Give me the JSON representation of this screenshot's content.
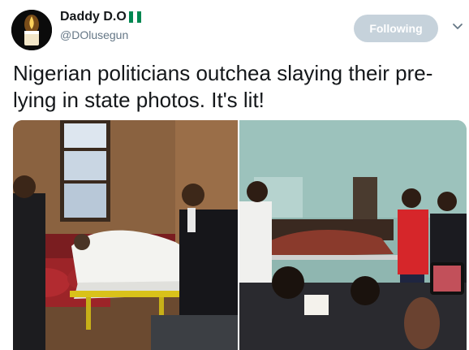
{
  "author": {
    "display_name": "Daddy D.O",
    "handle": "@DOlusegun",
    "flag_colors": [
      "#008751",
      "#ffffff",
      "#008751"
    ]
  },
  "follow_button": {
    "label": "Following",
    "color": "#c6d2db"
  },
  "tweet": {
    "text": "Nigerian politicians outchea slaying their pre-lying in state photos. It's lit!"
  },
  "media": [
    {
      "name": "photo-hospital-stretcher-left"
    },
    {
      "name": "photo-hospital-ward-right"
    }
  ],
  "icons": {
    "menu": "chevron-down-icon",
    "avatar": "candle-avatar"
  }
}
